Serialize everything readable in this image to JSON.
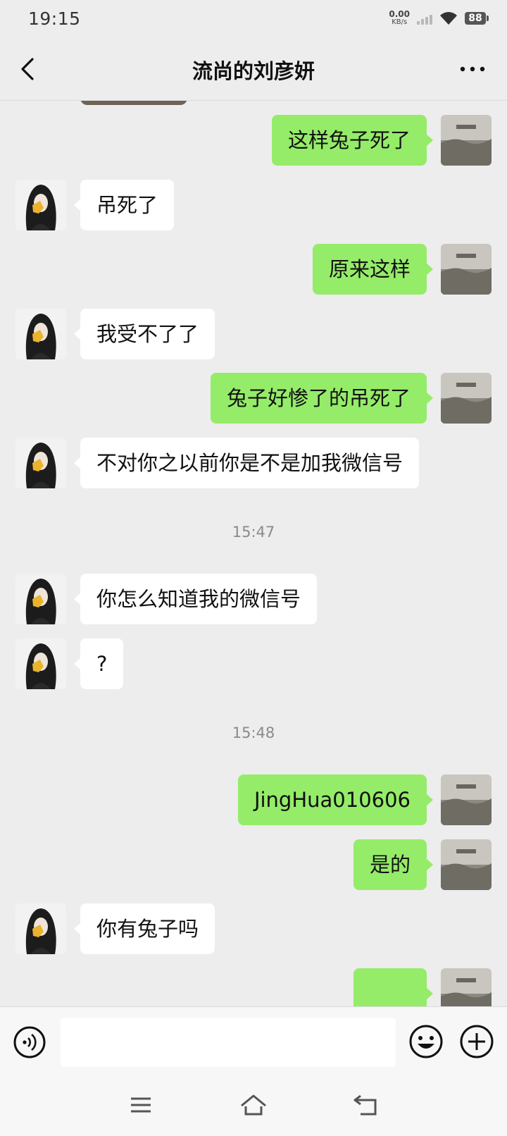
{
  "status_bar": {
    "time": "19:15",
    "net_speed_value": "0.00",
    "net_speed_unit": "KB/s",
    "battery": "88"
  },
  "header": {
    "title": "流尚的刘彦妍",
    "back_icon": "chevron-left-icon",
    "more_icon": "more-dots-icon"
  },
  "colors": {
    "background": "#ededed",
    "own_bubble": "#95ec69",
    "other_bubble": "#ffffff",
    "timestamp": "#8a8a8a"
  },
  "messages": [
    {
      "side": "right",
      "text": "这样兔子死了"
    },
    {
      "side": "left",
      "text": "吊死了"
    },
    {
      "side": "right",
      "text": "原来这样"
    },
    {
      "side": "left",
      "text": "我受不了了"
    },
    {
      "side": "right",
      "text": "兔子好惨了的吊死了"
    },
    {
      "side": "left",
      "text": "不对你之以前你是不是加我微信号"
    },
    {
      "timestamp": "15:47"
    },
    {
      "side": "left",
      "text": "你怎么知道我的微信号"
    },
    {
      "side": "left",
      "text": "?"
    },
    {
      "timestamp": "15:48"
    },
    {
      "side": "right",
      "text": "JingHua010606"
    },
    {
      "side": "right",
      "text": "是的"
    },
    {
      "side": "left",
      "text": "你有兔子吗"
    }
  ],
  "input_bar": {
    "text_value": "",
    "voice_icon": "voice-icon",
    "emoji_icon": "emoji-icon",
    "plus_icon": "plus-circle-icon"
  },
  "nav_bar": {
    "menu_icon": "menu-icon",
    "home_icon": "home-icon",
    "back_icon": "back-icon"
  }
}
